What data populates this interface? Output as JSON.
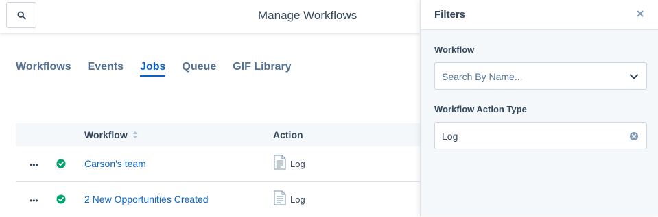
{
  "header": {
    "title": "Manage Workflows",
    "search_icon": "search-icon"
  },
  "tabs": [
    {
      "label": "Workflows",
      "active": false
    },
    {
      "label": "Events",
      "active": false
    },
    {
      "label": "Jobs",
      "active": true
    },
    {
      "label": "Queue",
      "active": false
    },
    {
      "label": "GIF Library",
      "active": false
    }
  ],
  "table": {
    "columns": {
      "workflow": "Workflow",
      "action": "Action"
    },
    "rows": [
      {
        "workflow": "Carson's team",
        "action": "Log",
        "status": "success"
      },
      {
        "workflow": "2 New Opportunities Created",
        "action": "Log",
        "status": "success"
      }
    ]
  },
  "filters": {
    "title": "Filters",
    "workflow": {
      "label": "Workflow",
      "placeholder": "Search By Name..."
    },
    "action_type": {
      "label": "Workflow Action Type",
      "value": "Log"
    }
  },
  "colors": {
    "link": "#0b63c6",
    "success": "#00a36a",
    "text": "#33475b",
    "panel_bg": "#f5f8fa"
  }
}
